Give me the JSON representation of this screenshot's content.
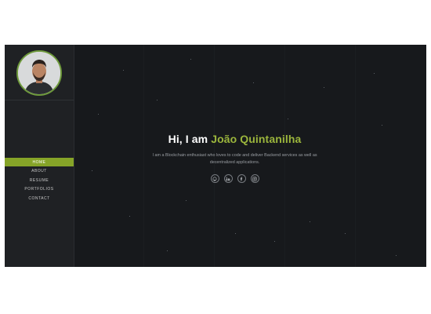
{
  "sidebar": {
    "avatar_icon": "profile-photo",
    "nav": [
      {
        "label": "HOME",
        "active": true
      },
      {
        "label": "ABOUT"
      },
      {
        "label": "RESUME"
      },
      {
        "label": "PORTFOLIOS"
      },
      {
        "label": "CONTACT"
      }
    ]
  },
  "hero": {
    "greeting": "Hi, I am ",
    "name": "João Quintanilha",
    "description": "I am a Blockchain enthusiast who loves to code and deliver Backend services as well as decentralized applications.",
    "socials": [
      {
        "icon": "github-icon"
      },
      {
        "icon": "linkedin-icon"
      },
      {
        "icon": "facebook-icon"
      },
      {
        "icon": "instagram-icon"
      }
    ]
  },
  "colors": {
    "accent": "#86a428",
    "name": "#9bb53c",
    "background": "#17191c",
    "sidebar": "#1f2124"
  }
}
